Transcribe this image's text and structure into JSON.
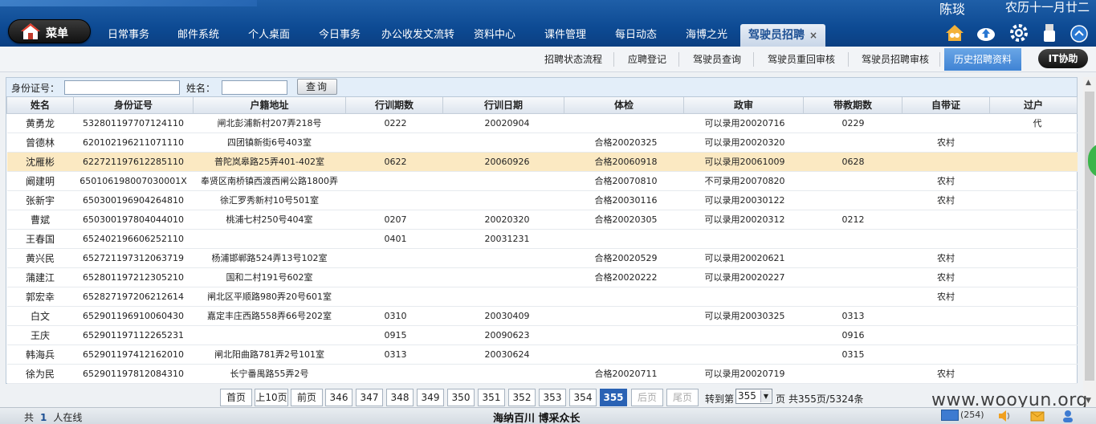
{
  "header": {
    "user_name": "陈琰",
    "lunar_date": "农历十一月廿二",
    "menu_label": "菜单",
    "nav": [
      {
        "label": "日常事务"
      },
      {
        "label": "邮件系统"
      },
      {
        "label": "个人桌面"
      },
      {
        "label": "今日事务"
      },
      {
        "label": "办公收发文流转"
      },
      {
        "label": "资料中心"
      },
      {
        "label": "课件管理"
      },
      {
        "label": "每日动态"
      },
      {
        "label": "海博之光"
      },
      {
        "label": "驾驶员招聘",
        "active": true
      }
    ],
    "close_symbol": "×",
    "icons": [
      "home-people-icon",
      "cloud-upload-icon",
      "gear-icon",
      "usb-drive-icon",
      "scroll-up-icon"
    ]
  },
  "subnav": {
    "items": [
      {
        "label": "招聘状态流程"
      },
      {
        "label": "应聘登记"
      },
      {
        "label": "驾驶员查询"
      },
      {
        "label": "驾驶员重回审核"
      },
      {
        "label": "驾驶员招聘审核"
      },
      {
        "label": "历史招聘资料",
        "active": true
      }
    ],
    "it_help": "IT协助"
  },
  "search": {
    "id_label": "身份证号：",
    "id_value": "",
    "name_label": "姓名：",
    "name_value": "",
    "query_button": "查询"
  },
  "table": {
    "columns": [
      "姓名",
      "身份证号",
      "户籍地址",
      "行训期数",
      "行训日期",
      "体检",
      "政审",
      "带教期数",
      "自带证",
      "过户"
    ],
    "rows": [
      [
        "黄勇龙",
        "532801197707124110",
        "闸北彭浦新村207弄218号",
        "0222",
        "20020904",
        "",
        "可以录用20020716",
        "0229",
        "",
        "代"
      ],
      [
        "曾德林",
        "620102196211071110",
        "四团镇新街6号403室",
        "",
        "",
        "合格20020325",
        "可以录用20020320",
        "",
        "农村",
        ""
      ],
      [
        "沈雁彬",
        "622721197612285110",
        "普陀岚皋路25弄401-402室",
        "0622",
        "20060926",
        "合格20060918",
        "可以录用20061009",
        "0628",
        "",
        ""
      ],
      [
        "阚建明",
        "650106198007030001X",
        "奉贤区南桥镇西渡西闸公路1800弄",
        "",
        "",
        "合格20070810",
        "不可录用20070820",
        "",
        "农村",
        ""
      ],
      [
        "张新宇",
        "650300196904264810",
        "徐汇罗秀新村10号501室",
        "",
        "",
        "合格20030116",
        "可以录用20030122",
        "",
        "农村",
        ""
      ],
      [
        "曹斌",
        "650300197804044010",
        "桃浦七村250号404室",
        "0207",
        "20020320",
        "合格20020305",
        "可以录用20020312",
        "0212",
        "",
        ""
      ],
      [
        "王春国",
        "652402196606252110",
        "",
        "0401",
        "20031231",
        "",
        "",
        "",
        "",
        ""
      ],
      [
        "黄兴民",
        "652721197312063719",
        "杨浦邯郸路524弄13号102室",
        "",
        "",
        "合格20020529",
        "可以录用20020621",
        "",
        "农村",
        ""
      ],
      [
        "蒲建江",
        "652801197212305210",
        "国和二村191号602室",
        "",
        "",
        "合格20020222",
        "可以录用20020227",
        "",
        "农村",
        ""
      ],
      [
        "郭宏幸",
        "652827197206212614",
        "闸北区平顺路980弄20号601室",
        "",
        "",
        "",
        "",
        "",
        "农村",
        ""
      ],
      [
        "白文",
        "652901196910060430",
        "嘉定丰庄西路558弄66号202室",
        "0310",
        "20030409",
        "",
        "可以录用20030325",
        "0313",
        "",
        ""
      ],
      [
        "王庆",
        "652901197112265231",
        "",
        "0915",
        "20090623",
        "",
        "",
        "0916",
        "",
        ""
      ],
      [
        "韩海兵",
        "652901197412162010",
        "闸北阳曲路781弄2号101室",
        "0313",
        "20030624",
        "",
        "",
        "0315",
        "",
        ""
      ],
      [
        "徐为民",
        "652901197812084310",
        "长宁番禺路55弄2号",
        "",
        "",
        "合格20020711",
        "可以录用20020719",
        "",
        "农村",
        ""
      ]
    ],
    "highlight_row": 2
  },
  "pager": {
    "first": "首页",
    "prev10": "上10页",
    "prev": "前页",
    "pages": [
      "346",
      "347",
      "348",
      "349",
      "350",
      "351",
      "352",
      "353",
      "354",
      "355"
    ],
    "current": "355",
    "next": "后页",
    "last": "尾页",
    "goto_label": "转到第",
    "goto_value": "355",
    "page_unit": "页",
    "summary": "共355页/5324条"
  },
  "footer": {
    "online_prefix": "共",
    "online_count": "1",
    "online_suffix": "人在线",
    "slogan": "海纳百川  博采众长",
    "mail_count": "(254)"
  },
  "watermark": "www.wooyun.org",
  "colors": {
    "header_blue": "#0d4a93",
    "active_tab_blue": "#3f83d4",
    "highlight_row": "#fbe9c2",
    "current_page": "#2a62b4"
  }
}
